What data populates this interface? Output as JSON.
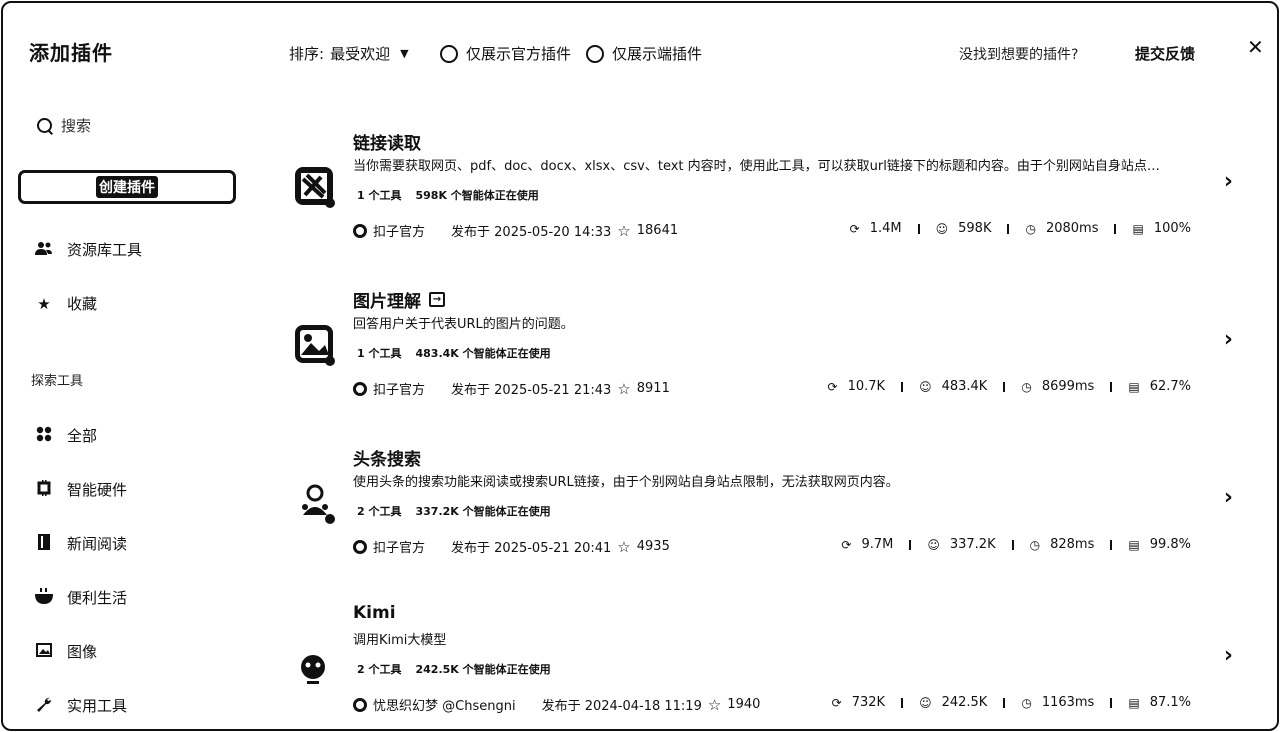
{
  "header": {
    "title": "添加插件",
    "sort_label": "排序:",
    "sort_value": "最受欢迎",
    "filter_official": "仅展示官方插件",
    "filter_device": "仅展示端插件",
    "not_found": "没找到想要的插件?",
    "feedback": "提交反馈",
    "close": "✕"
  },
  "sidebar": {
    "search_placeholder": "搜索",
    "create_button": "创建插件",
    "items": [
      {
        "label": "资源库工具",
        "icon": "users-icon"
      },
      {
        "label": "收藏",
        "icon": "star-icon"
      }
    ],
    "section_title": "探索工具",
    "categories": [
      {
        "label": "全部",
        "icon": "grid-icon"
      },
      {
        "label": "智能硬件",
        "icon": "chip-icon"
      },
      {
        "label": "新闻阅读",
        "icon": "book-icon"
      },
      {
        "label": "便利生活",
        "icon": "cup-icon"
      },
      {
        "label": "图像",
        "icon": "image-icon"
      },
      {
        "label": "实用工具",
        "icon": "wrench-icon"
      }
    ]
  },
  "plugins": [
    {
      "name": "链接读取",
      "description": "当你需要获取网页、pdf、doc、docx、xlsx、csv、text 内容时，使用此工具，可以获取url链接下的标题和内容。由于个别网站自身站点…",
      "tools": "1 个工具",
      "agents": "598K 个智能体正在使用",
      "author": "扣子官方",
      "published": "发布于 2025-05-20 14:33",
      "stars": "18641",
      "calls": "1.4M",
      "bots": "598K",
      "latency": "2080ms",
      "success": "100%"
    },
    {
      "name": "图片理解",
      "description": "回答用户关于代表URL的图片的问题。",
      "tools": "1 个工具",
      "agents": "483.4K 个智能体正在使用",
      "author": "扣子官方",
      "published": "发布于 2025-05-21 21:43",
      "stars": "8911",
      "calls": "10.7K",
      "bots": "483.4K",
      "latency": "8699ms",
      "success": "62.7%"
    },
    {
      "name": "头条搜索",
      "description": "使用头条的搜索功能来阅读或搜索URL链接，由于个别网站自身站点限制，无法获取网页内容。",
      "tools": "2 个工具",
      "agents": "337.2K 个智能体正在使用",
      "author": "扣子官方",
      "published": "发布于 2025-05-21 20:41",
      "stars": "4935",
      "calls": "9.7M",
      "bots": "337.2K",
      "latency": "828ms",
      "success": "99.8%"
    },
    {
      "name": "Kimi",
      "description": "调用Kimi大模型",
      "tools": "2 个工具",
      "agents": "242.5K 个智能体正在使用",
      "author": "忧思织幻梦 @Chsengni",
      "published": "发布于 2024-04-18 11:19",
      "stars": "1940",
      "calls": "732K",
      "bots": "242.5K",
      "latency": "1163ms",
      "success": "87.1%"
    }
  ]
}
